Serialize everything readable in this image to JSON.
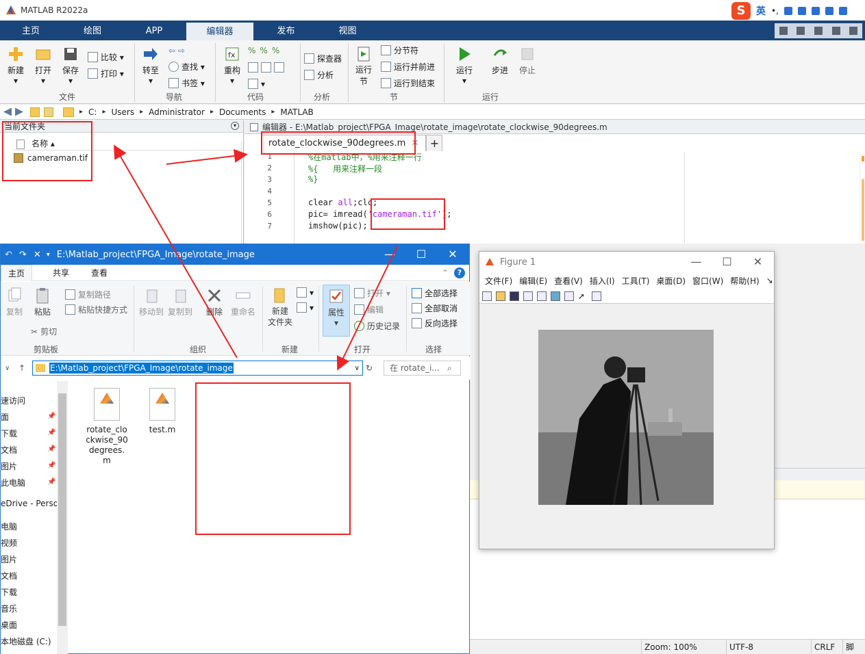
{
  "matlab": {
    "title": "MATLAB R2022a",
    "tabs": [
      "主页",
      "绘图",
      "APP",
      "编辑器",
      "发布",
      "视图"
    ],
    "active_tab": "编辑器",
    "ribbon": {
      "file": {
        "new": "新建",
        "open": "打开",
        "save": "保存",
        "compare": "比较",
        "print": "打印",
        "group": "文件"
      },
      "navigate": {
        "goto": "转至",
        "find": "查找",
        "bookmark": "书签",
        "group": "导航"
      },
      "code": {
        "refactor": "重构",
        "group": "代码"
      },
      "analyze": {
        "profiler": "探查器",
        "analyze": "分析",
        "group": "分析"
      },
      "section": {
        "run_section": "运行\n节",
        "section_break": "分节符",
        "run_advance": "运行并前进",
        "run_to_end": "运行到结束",
        "group": "节"
      },
      "run": {
        "run": "运行",
        "step": "步进",
        "stop": "停止",
        "group": "运行"
      }
    },
    "ime": {
      "lang": "英",
      "punct": "•,"
    },
    "path": [
      "C:",
      "Users",
      "Administrator",
      "Documents",
      "MATLAB"
    ],
    "current_folder": {
      "header": "当前文件夹",
      "col_name": "名称",
      "files": [
        "cameraman.tif"
      ]
    },
    "editor": {
      "header": "编辑器 - E:\\Matlab_project\\FPGA_Image\\rotate_image\\rotate_clockwise_90degrees.m",
      "tab": "rotate_clockwise_90degrees.m",
      "plus": "+",
      "line_numbers": [
        "1",
        "2",
        "3",
        "4",
        "5",
        "6",
        "7"
      ],
      "lines": {
        "l1": "%在matlab中，%用来注释一行",
        "l2": "%{   用来注释一段",
        "l3": "%}",
        "l5a": "clear ",
        "l5b": "all",
        "l5c": ";clc;",
        "l6a": "pic= imread(",
        "l6b": "'cameraman.tif'",
        "l6c": ");",
        "l7": "imshow(pic);"
      }
    },
    "status": {
      "zoom": "Zoom: 100%",
      "encoding": "UTF-8",
      "eol": "CRLF",
      "script": "脚"
    }
  },
  "explorer": {
    "title": "E:\\Matlab_project\\FPGA_Image\\rotate_image",
    "tabs": [
      "主页",
      "共享",
      "查看"
    ],
    "ribbon": {
      "copy": "复制",
      "paste": "粘贴",
      "copy_path": "复制路径",
      "paste_shortcut": "粘贴快捷方式",
      "cut": "剪切",
      "clipboard": "剪贴板",
      "move_to": "移动到",
      "copy_to": "复制到",
      "delete": "删除",
      "rename": "重命名",
      "organize": "组织",
      "new_folder": "新建\n文件夹",
      "new": "新建",
      "properties": "属性",
      "open": "打开",
      "edit": "编辑",
      "history": "历史记录",
      "open_group": "打开",
      "select_all": "全部选择",
      "select_none": "全部取消",
      "invert": "反向选择",
      "select": "选择"
    },
    "address": "E:\\Matlab_project\\FPGA_Image\\rotate_image",
    "search": "在 rotate_i...",
    "nav": [
      "速访问",
      "面",
      "下载",
      "文档",
      "图片",
      "此电脑",
      "eDrive - Perso",
      "电脑",
      "视频",
      "图片",
      "文档",
      "下载",
      "音乐",
      "桌面",
      "本地磁盘 (C:)"
    ],
    "files": [
      "rotate_clockwise_90degrees.m",
      "test.m"
    ],
    "file1_lines": [
      "rotate_clo",
      "ckwise_90",
      "degrees.",
      "m"
    ]
  },
  "figure": {
    "title": "Figure 1",
    "menu": [
      "文件(F)",
      "编辑(E)",
      "查看(V)",
      "插入(I)",
      "工具(T)",
      "桌面(D)",
      "窗口(W)",
      "帮助(H)"
    ]
  }
}
